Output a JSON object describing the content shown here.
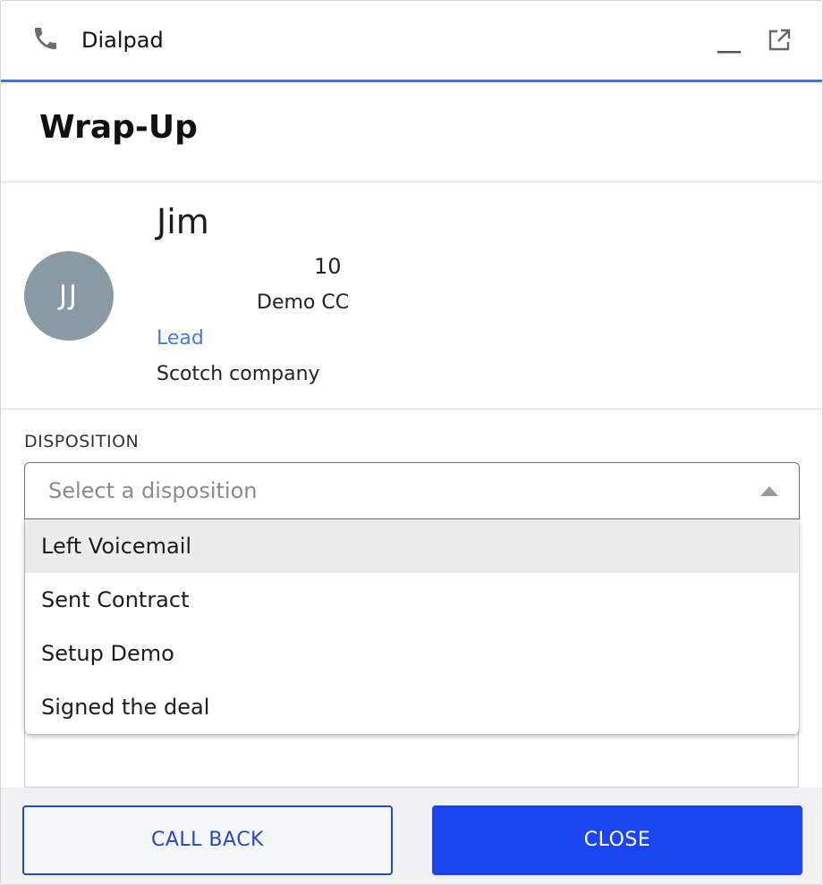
{
  "header": {
    "title": "Dialpad",
    "phone_icon": "phone-icon",
    "minimize_icon": "minimize-icon",
    "popout_icon": "external-link-icon",
    "accent_color": "#3b78d3"
  },
  "page": {
    "title": "Wrap-Up"
  },
  "contact": {
    "avatar_initials": "JJ",
    "avatar_color": "#8a9aa5",
    "name": "Jim",
    "number": "10",
    "team": "Demo CC",
    "link_label": "Lead",
    "company": "Scotch company"
  },
  "disposition": {
    "label": "DISPOSITION",
    "placeholder": "Select a disposition",
    "options": [
      "Left Voicemail",
      "Sent Contract",
      "Setup Demo",
      "Signed the deal"
    ],
    "highlighted_index": 0
  },
  "footer": {
    "call_back_label": "CALL BACK",
    "close_label": "CLOSE",
    "primary_color": "#1a45f0"
  }
}
